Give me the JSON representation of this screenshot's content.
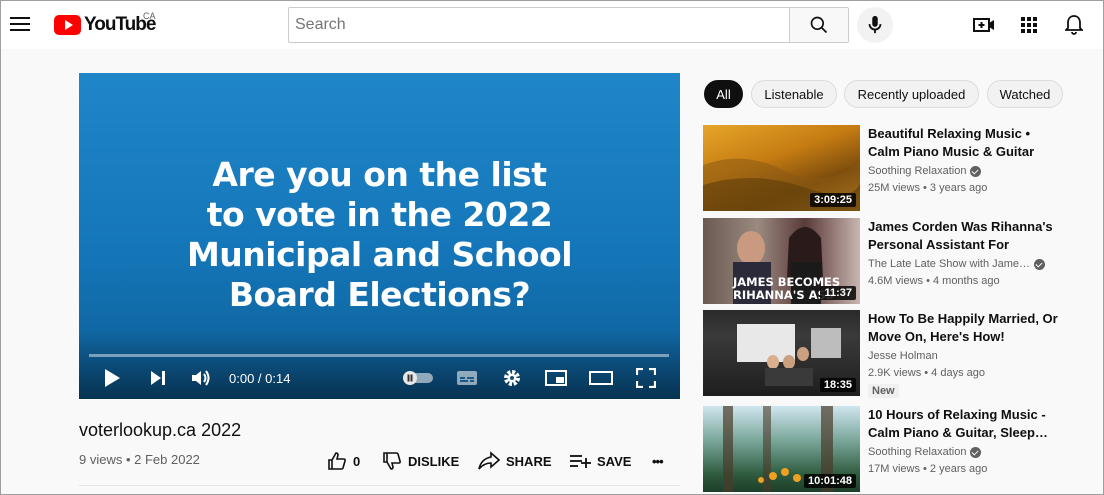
{
  "header": {
    "logo_text": "YouTube",
    "country": "CA",
    "search_placeholder": "Search"
  },
  "player": {
    "title_lines": [
      "Are you on the list",
      "to vote in the 2022",
      "Municipal and School",
      "Board Elections?"
    ],
    "time": "0:00 / 0:14",
    "progress": 0
  },
  "video": {
    "title": "voterlookup.ca 2022",
    "meta": "9 views • 2 Feb 2022",
    "like_count": "0",
    "dislike_label": "DISLIKE",
    "share_label": "SHARE",
    "save_label": "SAVE",
    "more_label": "•••"
  },
  "chips": [
    "All",
    "Listenable",
    "Recently uploaded",
    "Watched"
  ],
  "related": [
    {
      "title": "Beautiful Relaxing Music • Calm Piano Music & Guitar Music…",
      "channel": "Soothing Relaxation",
      "verified": true,
      "views": "25M views • 3 years ago",
      "duration": "3:09:25"
    },
    {
      "title": "James Corden Was Rihanna's Personal Assistant For SAVAG…",
      "channel": "The Late Late Show with Jame…",
      "verified": true,
      "views": "4.6M views • 4 months ago",
      "duration": "11:37",
      "thumb_text": [
        "JAMES BECOMES",
        "RIHANNA'S ASS"
      ]
    },
    {
      "title": "How To Be Happily Married, Or Move On, Here's How!",
      "channel": "Jesse Holman",
      "verified": false,
      "views": "2.9K views • 4 days ago",
      "duration": "18:35",
      "badge": "New"
    },
    {
      "title": "10 Hours of Relaxing Music - Calm Piano & Guitar, Sleep…",
      "channel": "Soothing Relaxation",
      "verified": true,
      "views": "17M views • 2 years ago",
      "duration": "10:01:48"
    }
  ],
  "colors": {
    "brand_red": "#ff0000",
    "chip_active": "#0f0f0f",
    "player_blue": "#1476b8"
  }
}
